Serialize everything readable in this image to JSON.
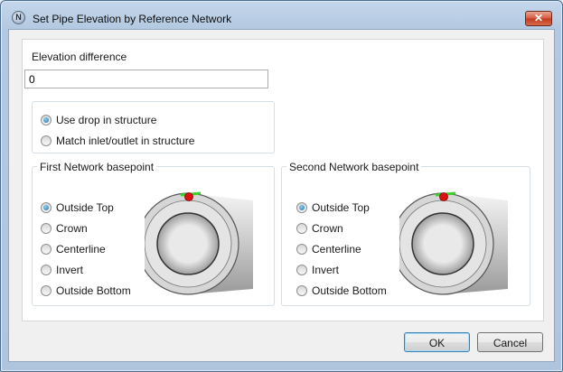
{
  "window": {
    "title": "Set Pipe Elevation by Reference Network",
    "icon_letter": "N",
    "close_symbol": "✕"
  },
  "elevation": {
    "label": "Elevation difference",
    "value": "0"
  },
  "structure_options": [
    {
      "label": "Use drop in structure",
      "selected": true
    },
    {
      "label": "Match inlet/outlet in structure",
      "selected": false
    }
  ],
  "first_network": {
    "title": "First Network basepoint",
    "options": [
      {
        "label": "Outside Top",
        "selected": true
      },
      {
        "label": "Crown",
        "selected": false
      },
      {
        "label": "Centerline",
        "selected": false
      },
      {
        "label": "Invert",
        "selected": false
      },
      {
        "label": "Outside Bottom",
        "selected": false
      }
    ]
  },
  "second_network": {
    "title": "Second Network basepoint",
    "options": [
      {
        "label": "Outside Top",
        "selected": true
      },
      {
        "label": "Crown",
        "selected": false
      },
      {
        "label": "Centerline",
        "selected": false
      },
      {
        "label": "Invert",
        "selected": false
      },
      {
        "label": "Outside Bottom",
        "selected": false
      }
    ]
  },
  "buttons": {
    "ok": "OK",
    "cancel": "Cancel"
  },
  "colors": {
    "marker_red": "#e01010",
    "marker_green": "#3fcf2f",
    "selected_radio": "#1b6fa8"
  },
  "icons": {
    "app": "app-n-icon",
    "close": "close-icon",
    "pipe_diagram": "pipe-section-icon"
  }
}
